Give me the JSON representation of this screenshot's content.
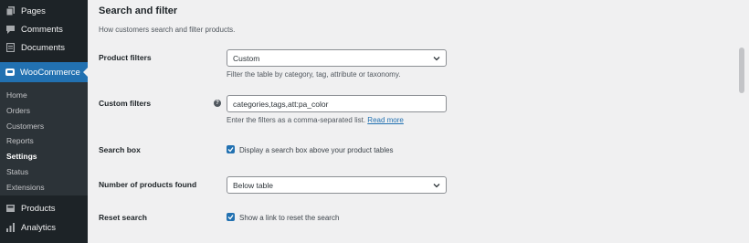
{
  "sidebar": {
    "top_items": [
      {
        "label": "Pages",
        "icon": "pages-icon"
      },
      {
        "label": "Comments",
        "icon": "comments-icon"
      },
      {
        "label": "Documents",
        "icon": "documents-icon"
      }
    ],
    "active": {
      "label": "WooCommerce",
      "icon": "woocommerce-icon"
    },
    "submenu": [
      {
        "label": "Home"
      },
      {
        "label": "Orders"
      },
      {
        "label": "Customers"
      },
      {
        "label": "Reports"
      },
      {
        "label": "Settings",
        "current": true
      },
      {
        "label": "Status"
      },
      {
        "label": "Extensions"
      }
    ],
    "bottom_items": [
      {
        "label": "Products",
        "icon": "products-icon"
      },
      {
        "label": "Analytics",
        "icon": "analytics-icon"
      }
    ]
  },
  "main": {
    "section_title": "Search and filter",
    "section_desc": "How customers search and filter products.",
    "product_filters": {
      "label": "Product filters",
      "value": "Custom",
      "desc": "Filter the table by category, tag, attribute or taxonomy."
    },
    "custom_filters": {
      "label": "Custom filters",
      "value": "categories,tags,att:pa_color",
      "desc": "Enter the filters as a comma-separated list.",
      "link": "Read more",
      "help": "?"
    },
    "search_box": {
      "label": "Search box",
      "checkbox_label": "Display a search box above your product tables",
      "checked": true
    },
    "num_products": {
      "label": "Number of products found",
      "value": "Below table"
    },
    "reset_search": {
      "label": "Reset search",
      "checkbox_label": "Show a link to reset the search",
      "checked": true
    }
  },
  "colors": {
    "sidebar_bg": "#1d2327",
    "submenu_bg": "#2c3338",
    "accent": "#2271b1",
    "page_bg": "#f0f0f1"
  }
}
